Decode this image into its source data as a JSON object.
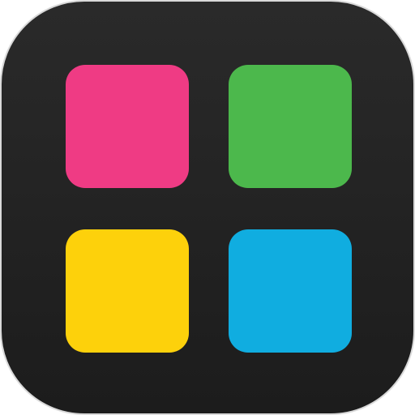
{
  "icon": {
    "background_color": "#222222",
    "tiles": [
      {
        "name": "pink",
        "color": "#ef3b84"
      },
      {
        "name": "green",
        "color": "#4cb84c"
      },
      {
        "name": "yellow",
        "color": "#fdd10b"
      },
      {
        "name": "blue",
        "color": "#10ade0"
      }
    ]
  }
}
